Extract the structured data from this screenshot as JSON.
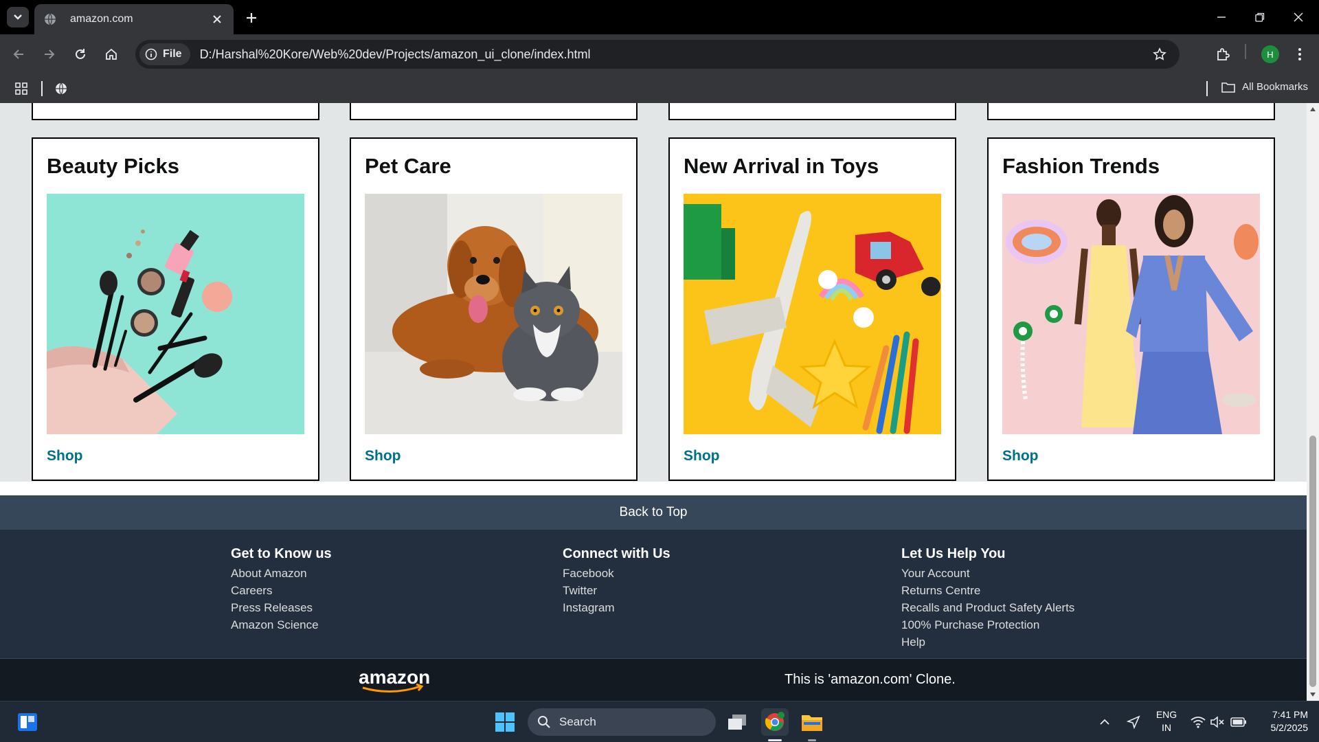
{
  "browser": {
    "tab_title": "amazon.com",
    "file_chip": "File",
    "url": "D:/Harshal%20Kore/Web%20dev/Projects/amazon_ui_clone/index.html",
    "profile_initial": "H",
    "all_bookmarks": "All Bookmarks"
  },
  "cards": [
    {
      "title": "Beauty Picks",
      "link": "Shop"
    },
    {
      "title": "Pet Care",
      "link": "Shop"
    },
    {
      "title": "New Arrival in Toys",
      "link": "Shop"
    },
    {
      "title": "Fashion Trends",
      "link": "Shop"
    }
  ],
  "footer": {
    "back_to_top": "Back to Top",
    "columns": [
      {
        "heading": "Get to Know us",
        "links": [
          "About Amazon",
          "Careers",
          "Press Releases",
          "Amazon Science"
        ]
      },
      {
        "heading": "Connect with Us",
        "links": [
          "Facebook",
          "Twitter",
          "Instagram"
        ]
      },
      {
        "heading": "Let Us Help You",
        "links": [
          "Your Account",
          "Returns Centre",
          "Recalls and Product Safety Alerts",
          "100% Purchase Protection",
          "Help"
        ]
      }
    ],
    "logo_text": "amazon",
    "clone_note": "This is 'amazon.com' Clone."
  },
  "taskbar": {
    "search_label": "Search",
    "lang_top": "ENG",
    "lang_bottom": "IN",
    "time": "7:41 PM",
    "date": "5/2/2025"
  },
  "colors": {
    "link_teal": "#007185",
    "back_to_top_bg": "#37475a",
    "footer_bg": "#232f3e",
    "footer_bottom_bg": "#131a22",
    "page_bg": "#e3e6e6"
  }
}
